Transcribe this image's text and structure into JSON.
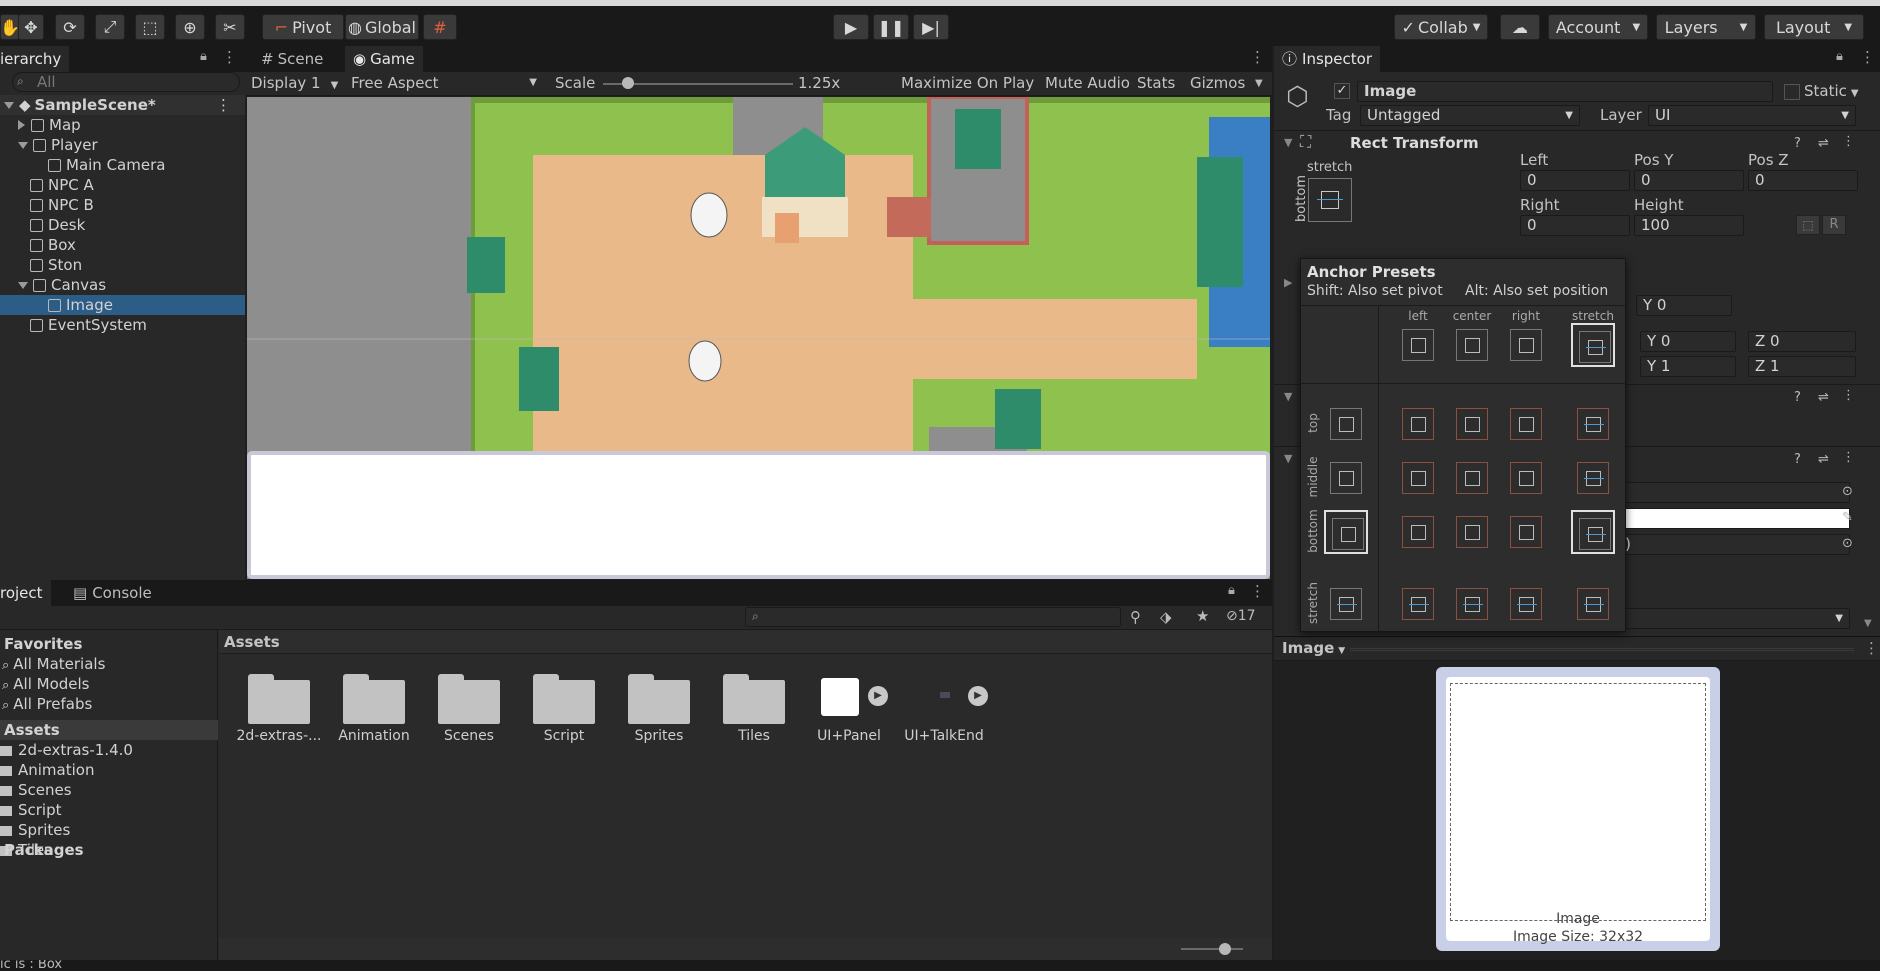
{
  "toolbar": {
    "pivot": "Pivot",
    "global": "Global",
    "collab": "Collab",
    "account": "Account",
    "layers": "Layers",
    "layout": "Layout"
  },
  "hierarchy": {
    "tab": "ierarchy",
    "search_placeholder": "All",
    "scene": "SampleScene*",
    "items": [
      {
        "label": "Map",
        "indent": 1,
        "arrow": "right"
      },
      {
        "label": "Player",
        "indent": 1,
        "arrow": "down"
      },
      {
        "label": "Main Camera",
        "indent": 2,
        "arrow": ""
      },
      {
        "label": "NPC A",
        "indent": 1,
        "arrow": ""
      },
      {
        "label": "NPC B",
        "indent": 1,
        "arrow": ""
      },
      {
        "label": "Desk",
        "indent": 1,
        "arrow": ""
      },
      {
        "label": "Box",
        "indent": 1,
        "arrow": ""
      },
      {
        "label": "Ston",
        "indent": 1,
        "arrow": ""
      },
      {
        "label": "Canvas",
        "indent": 1,
        "arrow": "down"
      },
      {
        "label": "Image",
        "indent": 2,
        "arrow": "",
        "selected": true
      },
      {
        "label": "EventSystem",
        "indent": 1,
        "arrow": ""
      }
    ]
  },
  "game": {
    "tab_scene": "Scene",
    "tab_game": "Game",
    "display": "Display 1",
    "aspect": "Free Aspect",
    "scale_label": "Scale",
    "scale_value": "1.25x",
    "scale_fraction": 0.1,
    "maximize": "Maximize On Play",
    "mute": "Mute Audio",
    "stats": "Stats",
    "gizmos": "Gizmos"
  },
  "project": {
    "tab_project": "roject",
    "tab_console": "Console",
    "hidden_count": "17",
    "favorites": "Favorites",
    "fav_items": [
      "All Materials",
      "All Models",
      "All Prefabs"
    ],
    "assets_header": "Assets",
    "asset_folders": [
      "2d-extras-1.4.0",
      "Animation",
      "Scenes",
      "Script",
      "Sprites",
      "Tiles"
    ],
    "packages": "Packages",
    "breadcrumb": "Assets",
    "grid": [
      "2d-extras-...",
      "Animation",
      "Scenes",
      "Script",
      "Sprites",
      "Tiles",
      "UI+Panel",
      "UI+TalkEnd"
    ]
  },
  "status": {
    "text": "ic is : Box"
  },
  "inspector": {
    "tab": "Inspector",
    "name": "Image",
    "static": "Static",
    "tag_label": "Tag",
    "tag_value": "Untagged",
    "layer_label": "Layer",
    "layer_value": "UI",
    "rect_transform": "Rect Transform",
    "stretch": "stretch",
    "bottom": "bottom",
    "left_label": "Left",
    "left_value": "0",
    "posy_label": "Pos Y",
    "posy_value": "0",
    "posz_label": "Pos Z",
    "posz_value": "0",
    "right_label": "Right",
    "right_value": "0",
    "height_label": "Height",
    "height_value": "100",
    "r_btn": "R",
    "y0": "Y 0",
    "y1": "Y 0",
    "z1": "Z 0",
    "y2": "Y 1",
    "z2": "Z 1",
    "color_trail": "l)",
    "preview_title": "Image",
    "preview_name": "Image",
    "preview_size": "Image Size: 32x32"
  },
  "anchor_presets": {
    "title": "Anchor Presets",
    "hint_pivot": "Shift: Also set pivot",
    "hint_pos": "Alt: Also set position",
    "cols": [
      "left",
      "center",
      "right",
      "stretch"
    ],
    "rows": [
      "top",
      "middle",
      "bottom",
      "stretch"
    ]
  },
  "colors": {
    "accent": "#2c5d87",
    "panel": "#282828",
    "dark": "#191919"
  }
}
